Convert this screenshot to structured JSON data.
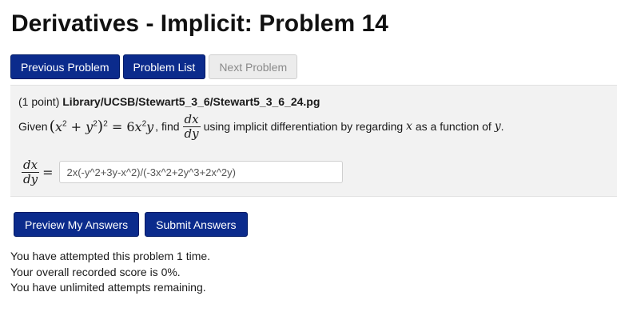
{
  "page": {
    "title": "Derivatives - Implicit: Problem 14"
  },
  "nav": {
    "previous": "Previous Problem",
    "list": "Problem List",
    "next": "Next Problem"
  },
  "problem": {
    "points": "(1 point)",
    "path": "Library/UCSB/Stewart5_3_6/Stewart5_3_6_24.pg",
    "given_label": "Given",
    "find_label": ", find",
    "using_text": "using implicit differentiation by regarding",
    "as_function_text": "as a function of",
    "var_x": "x",
    "var_y": "y",
    "dx": "dx",
    "dy": "dy"
  },
  "answer": {
    "value": "2x(-y^2+3y-x^2)/(-3x^2+2y^3+2x^2y)"
  },
  "actions": {
    "preview": "Preview My Answers",
    "submit": "Submit Answers"
  },
  "status": {
    "line1": "You have attempted this problem 1 time.",
    "line2": "Your overall recorded score is 0%.",
    "line3": "You have unlimited attempts remaining."
  }
}
